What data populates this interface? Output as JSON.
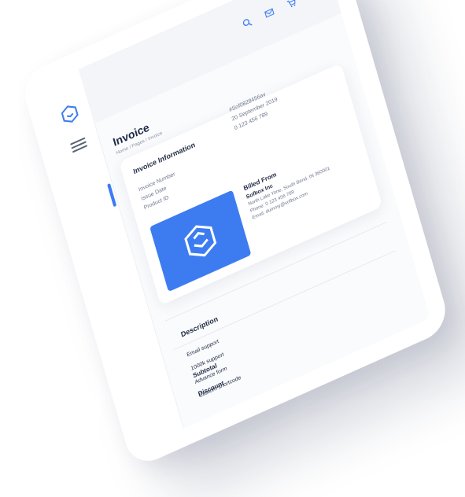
{
  "header": {
    "page_title": "Invoice",
    "breadcrumb": "Home / Pages / Invoice",
    "icons": [
      "search-icon",
      "mail-icon",
      "cart-icon",
      "bell-icon"
    ]
  },
  "invoice_info": {
    "title": "Invoice Information",
    "labels": [
      "Invoice Number",
      "Issue Date",
      "Product ID"
    ],
    "values": [
      "#Sof0828456av",
      "20 September 2019",
      "0 123 456 789"
    ]
  },
  "billed_from": {
    "title": "Billed From",
    "company": "Sofbox Inc",
    "address": "North Lake Yone, South Bend, IN 360001",
    "phone": "Phone: 0 123 456 789",
    "email": "Email: dummy@sofbox.com"
  },
  "description": {
    "title": "Description",
    "items": [
      "Email support",
      "1000k support",
      "Advance form",
      "Custom shortcode"
    ]
  },
  "totals": {
    "subtotal_label": "Subtotal",
    "discount_label": "Discount"
  },
  "colors": {
    "accent": "#3d7cf0",
    "background": "#fafbfd"
  }
}
